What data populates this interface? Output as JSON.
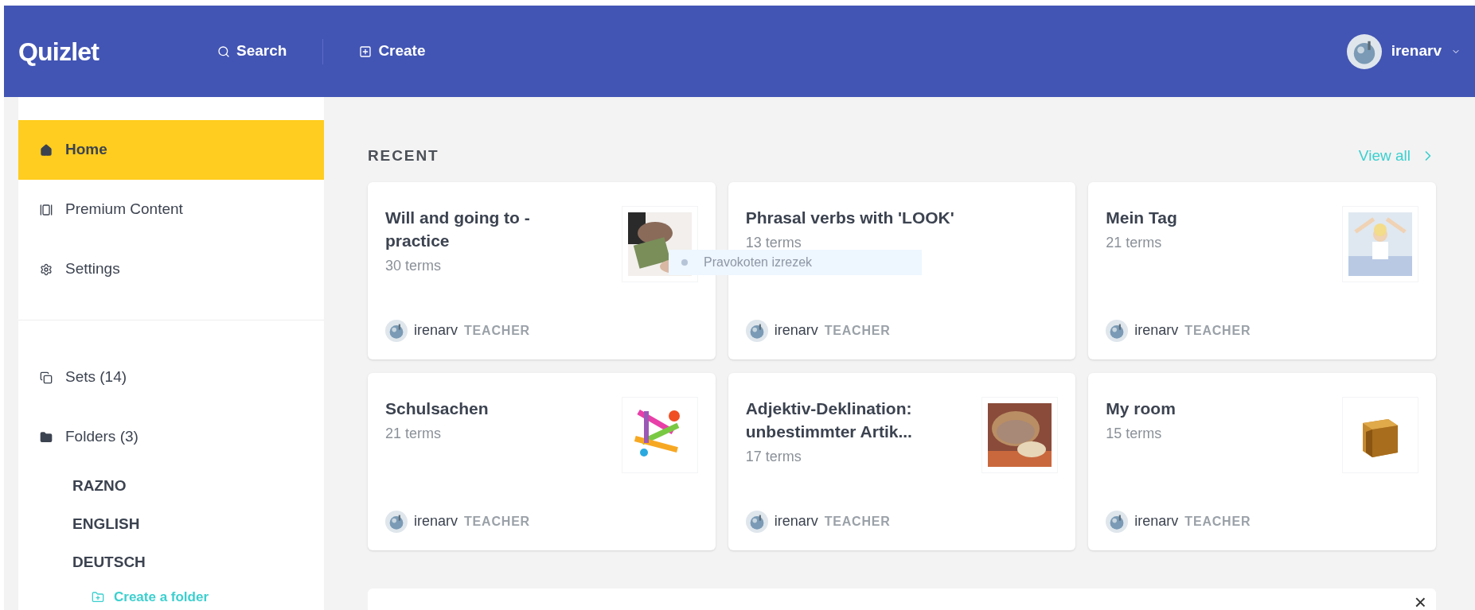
{
  "header": {
    "logo": "Quizlet",
    "nav": [
      {
        "kind": "search",
        "label": "Search"
      },
      {
        "kind": "create",
        "label": "Create"
      }
    ],
    "user": {
      "name": "irenarv"
    }
  },
  "sidebar": {
    "items": [
      {
        "kind": "home",
        "label": "Home",
        "selected": true
      },
      {
        "kind": "premium",
        "label": "Premium Content",
        "selected": false
      },
      {
        "kind": "settings",
        "label": "Settings",
        "selected": false
      }
    ],
    "library": [
      {
        "kind": "sets",
        "label": "Sets (14)"
      },
      {
        "kind": "folders",
        "label": "Folders (3)"
      }
    ],
    "folders": [
      "RAZNO",
      "ENGLISH",
      "DEUTSCH"
    ],
    "create_folder": "Create a folder"
  },
  "recent": {
    "title": "RECENT",
    "view_all": "View all",
    "cards": [
      {
        "title": "Will and going to - practice",
        "terms": "30 terms",
        "author": "irenarv",
        "role": "TEACHER",
        "kind": "picture"
      },
      {
        "title": "Phrasal verbs with 'LOOK'",
        "terms": "13 terms",
        "author": "irenarv",
        "role": "TEACHER"
      },
      {
        "title": "Mein Tag",
        "terms": "21 terms",
        "author": "irenarv",
        "role": "TEACHER",
        "kind": "picture"
      },
      {
        "title": "Schulsachen",
        "terms": "21 terms",
        "author": "irenarv",
        "role": "TEACHER",
        "kind": "picture"
      },
      {
        "title": "Adjektiv-Deklination: unbestimmter Artik...",
        "terms": "17 terms",
        "author": "irenarv",
        "role": "TEACHER",
        "kind": "picture"
      },
      {
        "title": "My room",
        "terms": "15 terms",
        "author": "irenarv",
        "role": "TEACHER",
        "kind": "picture"
      }
    ]
  },
  "overlay_hint": "Pravokoten izrezek",
  "banner": {
    "close": "×"
  }
}
